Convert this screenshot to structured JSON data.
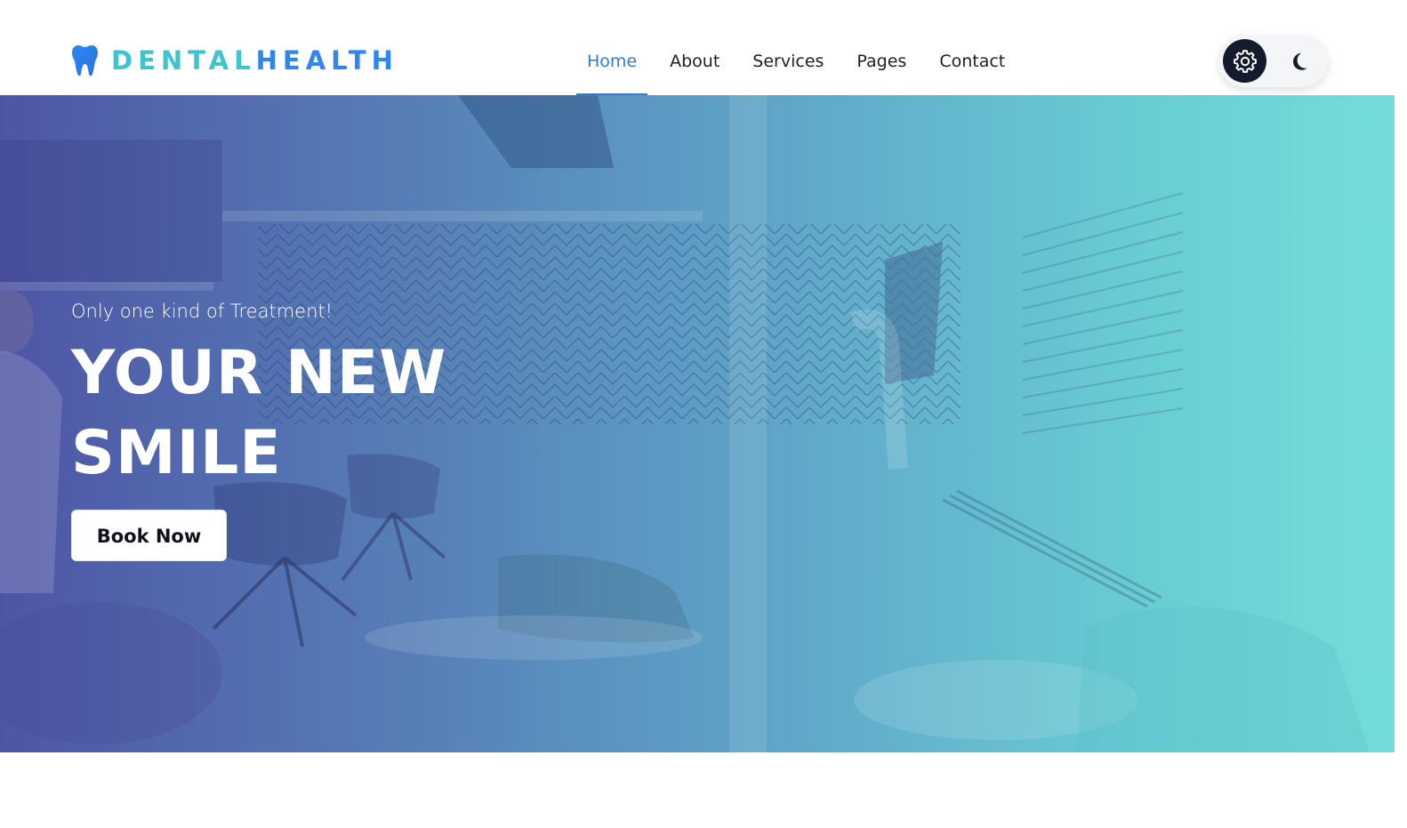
{
  "brand": {
    "name_part1": "DENTAL",
    "name_part2": "HEALTH",
    "icon": "tooth-icon",
    "colors": {
      "part1": "#3ec4cf",
      "part2": "#2f86f0"
    }
  },
  "nav": {
    "items": [
      {
        "label": "Home",
        "active": true
      },
      {
        "label": "About",
        "active": false
      },
      {
        "label": "Services",
        "active": false
      },
      {
        "label": "Pages",
        "active": false
      },
      {
        "label": "Contact",
        "active": false
      }
    ],
    "active_color": "#2b7fdc"
  },
  "theme_toggle": {
    "light_icon": "gear-icon",
    "dark_icon": "moon-icon",
    "selected": "light"
  },
  "hero": {
    "subtitle": "Only one kind of Treatment!",
    "title_line1": "YOUR NEW",
    "title_line2": "SMILE",
    "button_label": "Book Now",
    "gradient": [
      "#4e55a6",
      "#55d6d2"
    ]
  }
}
